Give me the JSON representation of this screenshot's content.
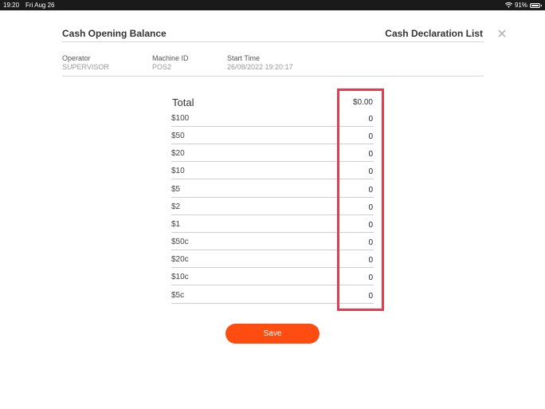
{
  "status_bar": {
    "time": "19:20",
    "date": "Fri Aug 26",
    "battery": "91%",
    "battery_level": 0.91,
    "wifi_icon": "wifi-icon",
    "battery_icon": "battery-icon"
  },
  "header": {
    "title": "Cash Opening Balance",
    "link": "Cash Declaration List",
    "close_icon": "close-icon"
  },
  "info": {
    "operator_label": "Operator",
    "operator_value": "SUPERVISOR",
    "machine_label": "Machine ID",
    "machine_value": "POS2",
    "start_label": "Start Time",
    "start_value": "26/08/2022 19:20:17"
  },
  "total": {
    "label": "Total",
    "value": "$0.00"
  },
  "denominations": [
    {
      "label": "$100",
      "value": "0"
    },
    {
      "label": "$50",
      "value": "0"
    },
    {
      "label": "$20",
      "value": "0"
    },
    {
      "label": "$10",
      "value": "0"
    },
    {
      "label": "$5",
      "value": "0"
    },
    {
      "label": "$2",
      "value": "0"
    },
    {
      "label": "$1",
      "value": "0"
    },
    {
      "label": "$50c",
      "value": "0"
    },
    {
      "label": "$20c",
      "value": "0"
    },
    {
      "label": "$10c",
      "value": "0"
    },
    {
      "label": "$5c",
      "value": "0"
    }
  ],
  "save_label": "Save",
  "colors": {
    "accent": "#ff4d12",
    "highlight": "#e63a4e"
  }
}
